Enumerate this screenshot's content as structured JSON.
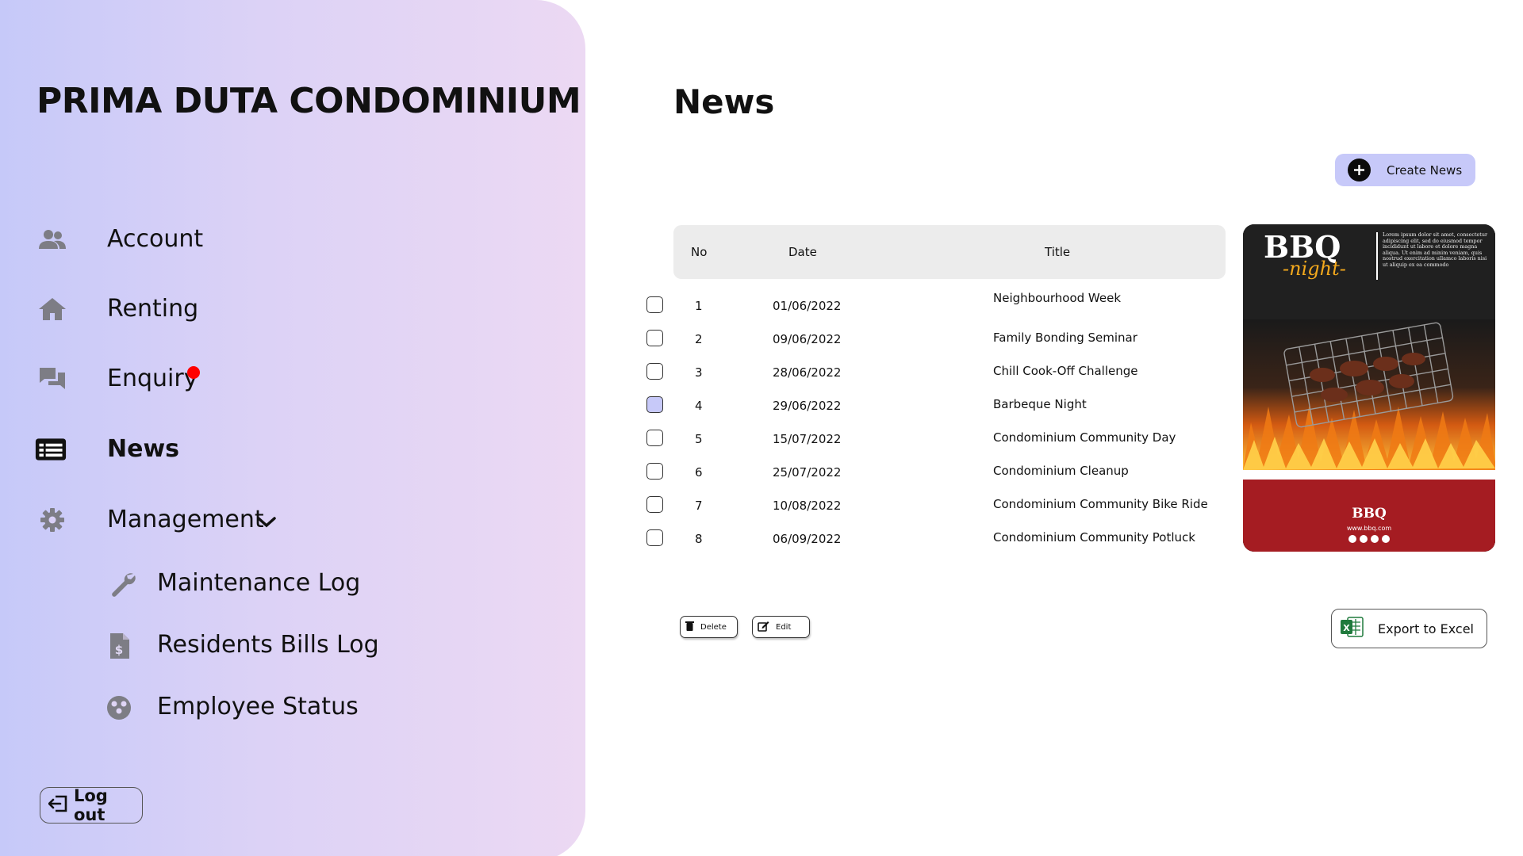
{
  "sidebar": {
    "brand": "PRIMA DUTA CONDOMINIUM",
    "items": [
      {
        "label": "Account",
        "icon": "users-icon"
      },
      {
        "label": "Renting",
        "icon": "home-icon"
      },
      {
        "label": "Enquiry",
        "icon": "chat-icon",
        "has_notification": true
      },
      {
        "label": "News",
        "icon": "newspaper-icon",
        "active": true
      },
      {
        "label": "Management",
        "icon": "gear-icon",
        "expanded": true
      }
    ],
    "sub_items": [
      {
        "label": "Maintenance Log",
        "icon": "wrench-icon"
      },
      {
        "label": "Residents Bills Log",
        "icon": "invoice-dollar-icon"
      },
      {
        "label": "Employee Status",
        "icon": "people-circle-icon"
      }
    ],
    "logout_label": "Log out"
  },
  "main": {
    "title": "News",
    "create_label": "Create News",
    "table": {
      "headers": {
        "no": "No",
        "date": "Date",
        "title": "Title"
      },
      "rows": [
        {
          "no": "1",
          "date": "01/06/2022",
          "title": "Neighbourhood Week",
          "checked": false
        },
        {
          "no": "2",
          "date": "09/06/2022",
          "title": "Family Bonding Seminar",
          "checked": false
        },
        {
          "no": "3",
          "date": "28/06/2022",
          "title": "Chill Cook-Off Challenge",
          "checked": false
        },
        {
          "no": "4",
          "date": "29/06/2022",
          "title": "Barbeque Night",
          "checked": true
        },
        {
          "no": "5",
          "date": "15/07/2022",
          "title": "Condominium Community Day",
          "checked": false
        },
        {
          "no": "6",
          "date": "25/07/2022",
          "title": "Condominium Cleanup",
          "checked": false
        },
        {
          "no": "7",
          "date": "10/08/2022",
          "title": "Condominium Community Bike Ride",
          "checked": false
        },
        {
          "no": "8",
          "date": "06/09/2022",
          "title": "Condominium Community Potluck",
          "checked": false
        }
      ]
    },
    "poster": {
      "headline": "BBQ",
      "script": "-night-",
      "blurb": "Lorem ipsum dolor sit amet, consectetur adipiscing elit, sed do eiusmod tempor incididunt ut labore et dolore magna aliqua. Ut enim ad minim veniam, quis nostrud exercitation ullamco laboris nisi ut aliquip ex ea commodo",
      "logo": "BBQ",
      "url": "www.bbq.com"
    },
    "delete_label": "Delete",
    "edit_label": "Edit",
    "export_label": "Export to Excel"
  },
  "colors": {
    "accent": "#c7c9f9",
    "notification": "#ff0000",
    "poster_red": "#a51c22",
    "excel_green": "#1f7a3c"
  }
}
